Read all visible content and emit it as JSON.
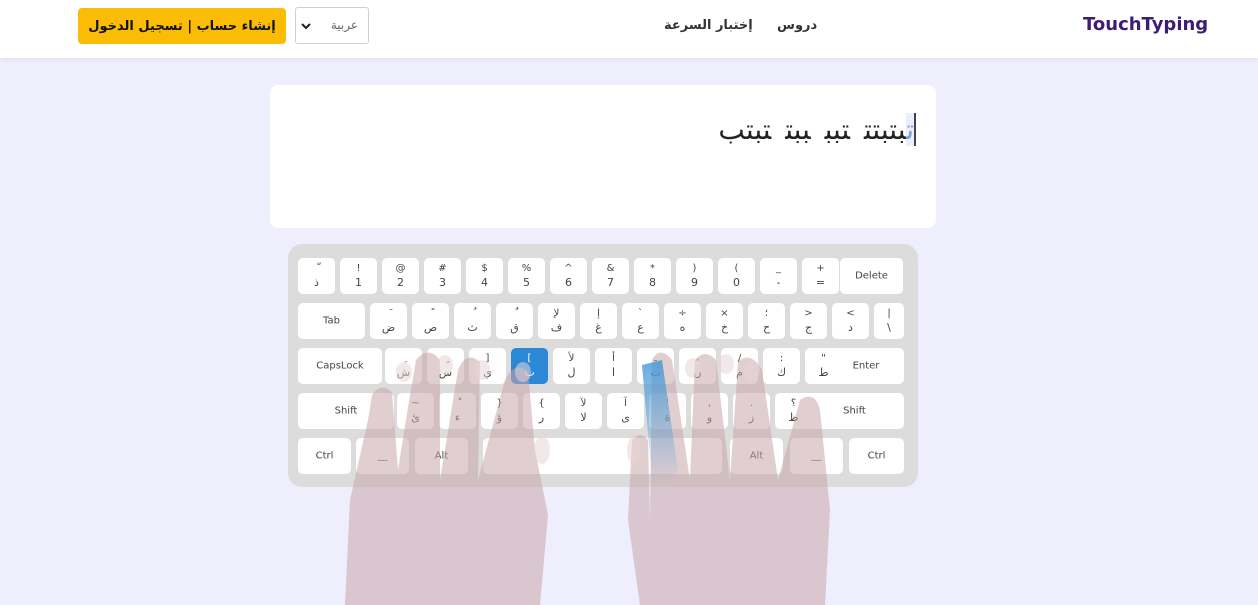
{
  "header": {
    "logo": "TouchTyping",
    "nav": [
      "دروس",
      "إختبار السرعة"
    ],
    "language_select": {
      "value": "عربية"
    },
    "cta": "إنشاء حساب | تسجيل الدخول"
  },
  "exercise": {
    "current_char": "ت",
    "rest_of_first_word": "بت",
    "words": [
      "بتت",
      "تبب",
      "ببت",
      "تبتب"
    ]
  },
  "keyboard": {
    "active_key": "ب",
    "rows": [
      [
        [
          "ّ",
          "ذ"
        ],
        [
          "!",
          "1"
        ],
        [
          "@",
          "2"
        ],
        [
          "#",
          "3"
        ],
        [
          "$",
          "4"
        ],
        [
          "%",
          "5"
        ],
        [
          "^",
          "6"
        ],
        [
          "&",
          "7"
        ],
        [
          "*",
          "8"
        ],
        [
          ")",
          "9"
        ],
        [
          "(",
          "0"
        ],
        [
          "_",
          "-"
        ],
        [
          "+",
          "="
        ],
        [
          "",
          "Delete"
        ]
      ],
      [
        [
          "",
          "Tab"
        ],
        [
          "َ",
          "ض"
        ],
        [
          "ً",
          "ص"
        ],
        [
          "ُ",
          "ث"
        ],
        [
          "ٌ",
          "ق"
        ],
        [
          "لإ",
          "ف"
        ],
        [
          "إ",
          "غ"
        ],
        [
          "`",
          "ع"
        ],
        [
          "÷",
          "ه"
        ],
        [
          "×",
          "خ"
        ],
        [
          "؛",
          "ح"
        ],
        [
          ">",
          "ج"
        ],
        [
          "<",
          "د"
        ],
        [
          "|",
          "\\"
        ]
      ],
      [
        [
          "",
          "CapsLock"
        ],
        [
          "ِ",
          "ش"
        ],
        [
          "ٍ",
          "س"
        ],
        [
          "]",
          "ي"
        ],
        [
          "[",
          "ب"
        ],
        [
          "لأ",
          "ل"
        ],
        [
          "أ",
          "ا"
        ],
        [
          "ـ",
          "ت"
        ],
        [
          "،",
          "ن"
        ],
        [
          "/",
          "م"
        ],
        [
          ":",
          "ك"
        ],
        [
          "\"",
          "ط"
        ],
        [
          "",
          "Enter"
        ]
      ],
      [
        [
          "",
          "Shift"
        ],
        [
          "~",
          "ئ"
        ],
        [
          "ْ",
          "ء"
        ],
        [
          "}",
          "ؤ"
        ],
        [
          "{",
          "ر"
        ],
        [
          "لآ",
          "لا"
        ],
        [
          "آ",
          "ى"
        ],
        [
          "'",
          "ة"
        ],
        [
          ",",
          "و"
        ],
        [
          ".",
          "ز"
        ],
        [
          "؟",
          "ظ"
        ],
        [
          "",
          "Shift"
        ]
      ],
      [
        [
          "",
          "Ctrl"
        ],
        [
          "",
          "__"
        ],
        [
          "",
          "Alt"
        ],
        [
          "",
          ""
        ],
        [
          "",
          "Alt"
        ],
        [
          "",
          "__"
        ],
        [
          "",
          "Ctrl"
        ]
      ]
    ]
  }
}
